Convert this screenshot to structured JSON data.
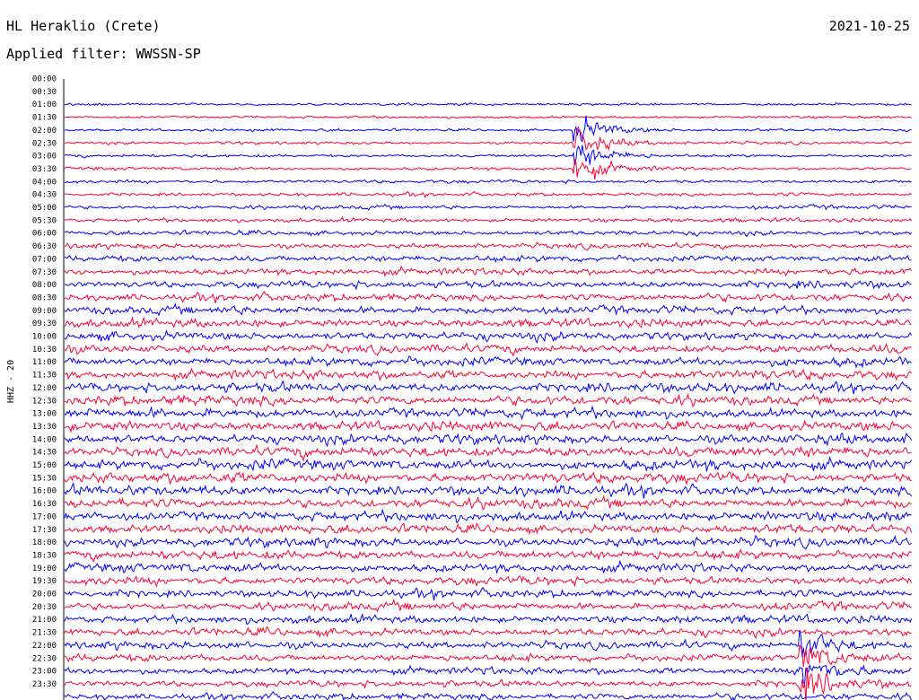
{
  "header": {
    "station": "HL Heraklio (Crete)",
    "date": "2021-10-25",
    "filter": "Applied filter: WWSSN-SP"
  },
  "chart_data": {
    "type": "line",
    "title": "HL Heraklio (Crete)",
    "ylabel": "HHZ - 20",
    "y_tick_labels": [
      "00:00",
      "00:30",
      "01:00",
      "01:30",
      "02:00",
      "02:30",
      "03:00",
      "03:30",
      "04:00",
      "04:30",
      "05:00",
      "05:30",
      "06:00",
      "06:30",
      "07:00",
      "07:30",
      "08:00",
      "08:30",
      "09:00",
      "09:30",
      "10:00",
      "10:30",
      "11:00",
      "11:30",
      "12:00",
      "12:30",
      "13:00",
      "13:30",
      "14:00",
      "14:30",
      "15:00",
      "15:30",
      "16:00",
      "16:30",
      "17:00",
      "17:30",
      "18:00",
      "18:30",
      "19:00",
      "19:30",
      "20:00",
      "20:30",
      "21:00",
      "21:30",
      "22:00",
      "22:30",
      "23:00",
      "23:30"
    ],
    "trace_colors": [
      "#0000ff",
      "#ff0033"
    ],
    "first_trace_row": 2,
    "noise_level_by_row": [
      0,
      0,
      0.22,
      0.22,
      0.24,
      0.26,
      0.26,
      0.28,
      0.3,
      0.32,
      0.34,
      0.36,
      0.4,
      0.46,
      0.55,
      0.6,
      0.62,
      0.65,
      0.68,
      0.72,
      0.75,
      0.75,
      0.78,
      0.8,
      0.82,
      0.85,
      0.85,
      0.88,
      0.88,
      0.9,
      0.9,
      0.9,
      0.88,
      0.86,
      0.84,
      0.82,
      0.8,
      0.78,
      0.76,
      0.74,
      0.72,
      0.7,
      0.68,
      0.68,
      0.66,
      0.64,
      0.62,
      0.6,
      0.58
    ],
    "events": [
      {
        "time_start": "02:00",
        "time_end": "04:00",
        "minute_offset": 18,
        "peak_amplitude": 3.2
      },
      {
        "time_start": "22:00",
        "time_end": "23:59",
        "minute_offset": 26,
        "peak_amplitude": 3.5
      }
    ],
    "grid": false,
    "legend": "none"
  }
}
